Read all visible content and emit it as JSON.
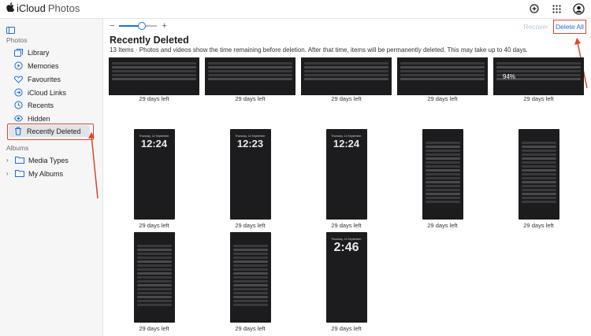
{
  "app": {
    "brand_apple": "",
    "brand_name": "iCloud",
    "brand_product": "Photos"
  },
  "topbar": {
    "icons": [
      "add-icon",
      "apps-grid-icon",
      "account-icon"
    ]
  },
  "sidebar": {
    "photos_heading": "Photos",
    "items": [
      {
        "label": "Library",
        "icon": "library-icon"
      },
      {
        "label": "Memories",
        "icon": "memories-icon"
      },
      {
        "label": "Favourites",
        "icon": "heart-icon"
      },
      {
        "label": "iCloud Links",
        "icon": "link-icon"
      },
      {
        "label": "Recents",
        "icon": "clock-icon"
      },
      {
        "label": "Hidden",
        "icon": "eye-icon"
      },
      {
        "label": "Recently Deleted",
        "icon": "trash-icon"
      }
    ],
    "albums_heading": "Albums",
    "groups": [
      {
        "label": "Media Types",
        "icon": "folder-icon"
      },
      {
        "label": "My Albums",
        "icon": "folder-icon"
      }
    ]
  },
  "toolbar": {
    "zoom_minus": "−",
    "zoom_plus": "+",
    "zoom_level": 0.6,
    "recover_label": "Recover",
    "delete_all_label": "Delete All"
  },
  "content": {
    "title": "Recently Deleted",
    "subtitle": "13 Items  ·  Photos and videos show the time remaining before deletion. After that time, items will be permanently deleted. This may take up to 40 days.",
    "items": [
      {
        "caption": "29 days left",
        "clock": "",
        "date": ""
      },
      {
        "caption": "29 days left",
        "clock": "",
        "date": ""
      },
      {
        "caption": "29 days left",
        "clock": "",
        "date": ""
      },
      {
        "caption": "29 days left",
        "clock": "",
        "date": ""
      },
      {
        "caption": "29 days left",
        "clock": "",
        "date": "",
        "badge": "94%"
      },
      {
        "caption": "29 days left",
        "clock": "12:24",
        "date": "Thursday, 14 September"
      },
      {
        "caption": "29 days left",
        "clock": "12:23",
        "date": "Thursday, 14 September"
      },
      {
        "caption": "29 days left",
        "clock": "12:24",
        "date": "Thursday, 14 September"
      },
      {
        "caption": "29 days left",
        "clock": "",
        "date": ""
      },
      {
        "caption": "29 days left",
        "clock": "",
        "date": ""
      },
      {
        "caption": "29 days left",
        "clock": "",
        "date": ""
      },
      {
        "caption": "29 days left",
        "clock": "",
        "date": ""
      },
      {
        "caption": "29 days left",
        "clock": "2:46",
        "date": "Thursday, 14 September"
      }
    ]
  }
}
